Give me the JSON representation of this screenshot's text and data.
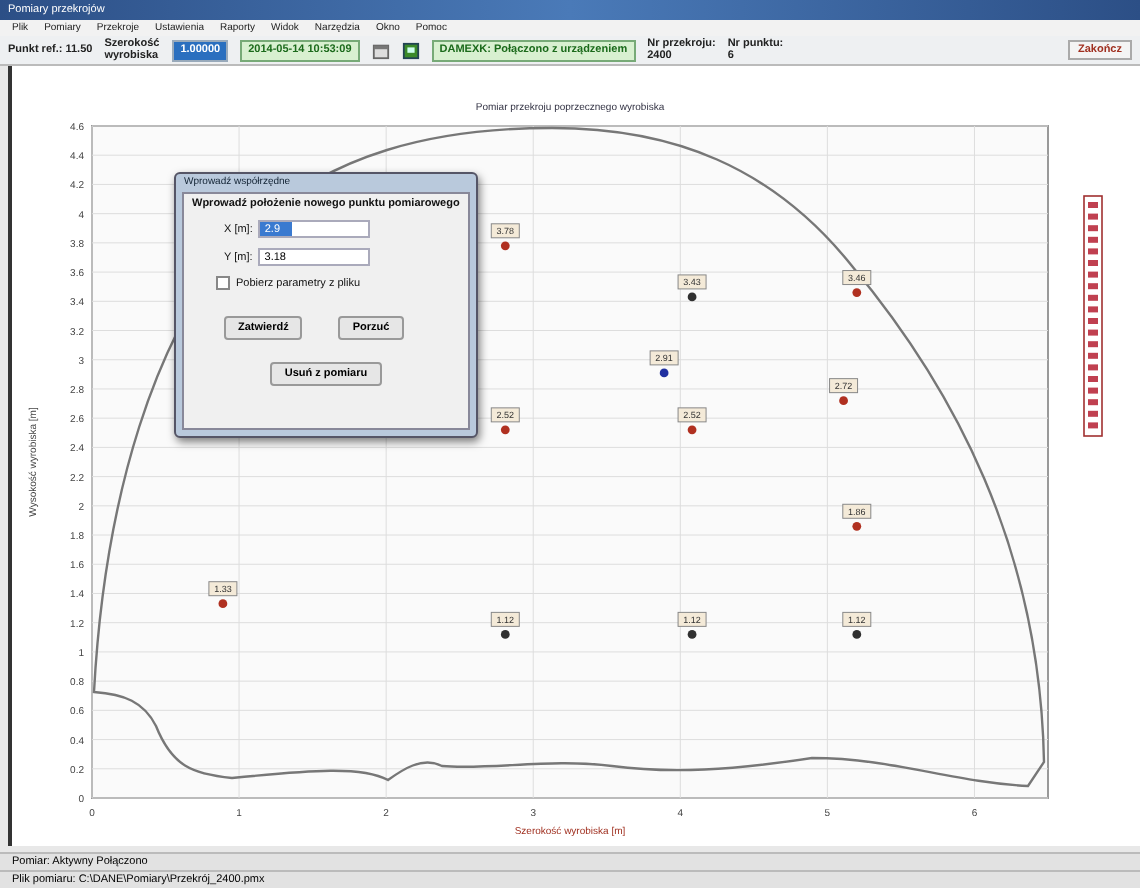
{
  "window": {
    "title": "Pomiary przekrojów"
  },
  "menu": [
    "Plik",
    "Pomiary",
    "Przekroje",
    "Ustawienia",
    "Raporty",
    "Widok",
    "Narzędzia",
    "Okno",
    "Pomoc"
  ],
  "toolbar": {
    "reference": "Punkt ref.: 11.50",
    "width_label": "Szerokość wyrobiska",
    "width_value": "1.00000",
    "datetime": "2014-05-14 10:53:09",
    "device": "DAMEXK: Połączono z urządzeniem",
    "section_label": "Nr przekroju:",
    "section_value": "2400",
    "point_label": "Nr punktu:",
    "point_value": "6",
    "exit": "Zakończ"
  },
  "chart": {
    "chart_data": {
      "type": "scatter",
      "title": "Pomiar przekroju poprzecznego wyrobiska",
      "xlabel": "Szerokość wyrobiska [m]",
      "ylabel": "Wysokość wyrobiska [m]",
      "xlim": [
        0,
        6.5
      ],
      "ylim": [
        0,
        4.6
      ],
      "xticks": [
        0,
        1,
        2,
        3,
        4,
        5,
        6
      ],
      "yticks": [
        0,
        0.2,
        0.4,
        0.6,
        0.8,
        1,
        1.2,
        1.4,
        1.6,
        1.8,
        2,
        2.2,
        2.4,
        2.6,
        2.8,
        3,
        3.2,
        3.4,
        3.6,
        3.8,
        4,
        4.2,
        4.4,
        4.6
      ],
      "data_labels": true,
      "grid": true,
      "series": [
        {
          "color": "#b03020",
          "x": [
            2.81,
            5.2,
            5.11,
            4.08,
            2.81,
            5.2,
            0.89
          ],
          "values": [
            3.78,
            3.46,
            2.72,
            2.52,
            2.52,
            1.86,
            1.33
          ]
        },
        {
          "color": "#303030",
          "x": [
            4.08,
            2.81,
            4.08,
            5.2
          ],
          "values": [
            3.43,
            1.12,
            1.12,
            1.12
          ]
        },
        {
          "color": "#2030a0",
          "x": [
            3.89
          ],
          "values": [
            2.91
          ]
        }
      ]
    }
  },
  "dialog": {
    "title": "Wprowadź współrzędne",
    "heading": "Wprowadź położenie nowego punktu pomiarowego",
    "fields": [
      {
        "label": "X [m]:",
        "value": "2.9",
        "selected": true
      },
      {
        "label": "Y [m]:",
        "value": "3.18",
        "selected": false
      }
    ],
    "checkbox": {
      "label": "Pobierz parametry z pliku",
      "checked": false
    },
    "buttons": [
      "Zatwierdź",
      "Porzuć"
    ],
    "remove_button": "Usuń z pomiaru"
  },
  "status_bar": [
    "Pomiar: Aktywny  Połączono",
    "Plik pomiaru: C:\\DANE\\Pomiary\\Przekrój_2400.pmx"
  ]
}
